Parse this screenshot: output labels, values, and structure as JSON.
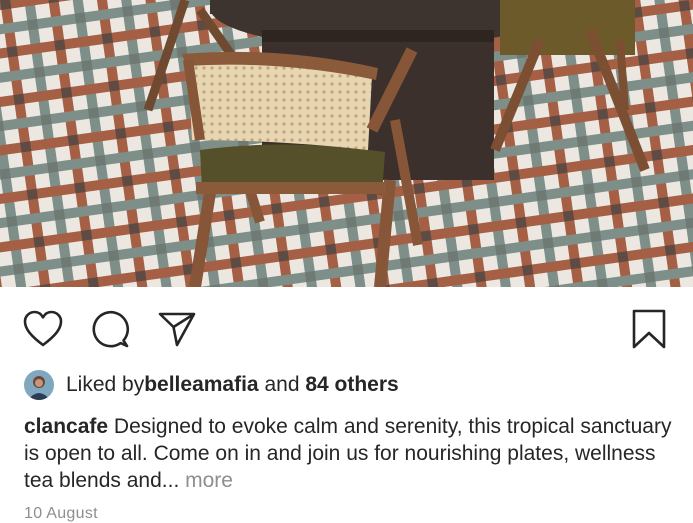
{
  "post": {
    "image_alt": "Cafe interior with rattan chair at a round wooden table on patterned tile floor",
    "actions": {
      "like_icon": "heart-icon",
      "comment_icon": "comment-icon",
      "share_icon": "share-icon",
      "save_icon": "bookmark-icon"
    },
    "likes": {
      "prefix": "Liked by ",
      "user": "belleamafia",
      "connector": " and ",
      "others": "84 others"
    },
    "caption": {
      "username": "clancafe",
      "text": " Designed to evoke calm and serenity, this tropical sanctuary is open to all. Come on in and join us for nourishing plates, wellness tea blends and... ",
      "more_label": "more"
    },
    "date": "10 August"
  },
  "colors": {
    "text": "#262626",
    "muted": "#8e8e8e",
    "background": "#ffffff"
  }
}
